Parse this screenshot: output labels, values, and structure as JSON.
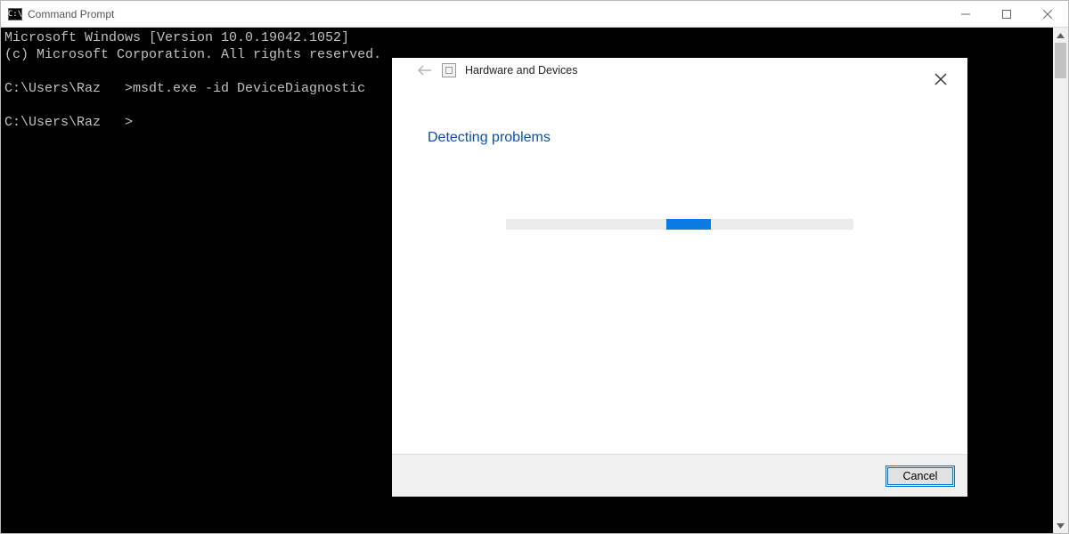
{
  "cmd": {
    "title": "Command Prompt",
    "icon_text": "C:\\",
    "lines": {
      "l1": "Microsoft Windows [Version 10.0.19042.1052]",
      "l2": "(c) Microsoft Corporation. All rights reserved.",
      "l3": "",
      "l4": "C:\\Users\\Raz   >msdt.exe -id DeviceDiagnostic",
      "l5": "",
      "l6": "C:\\Users\\Raz   >"
    }
  },
  "dialog": {
    "header_title": "Hardware and Devices",
    "heading": "Detecting problems",
    "cancel_label": "Cancel"
  }
}
